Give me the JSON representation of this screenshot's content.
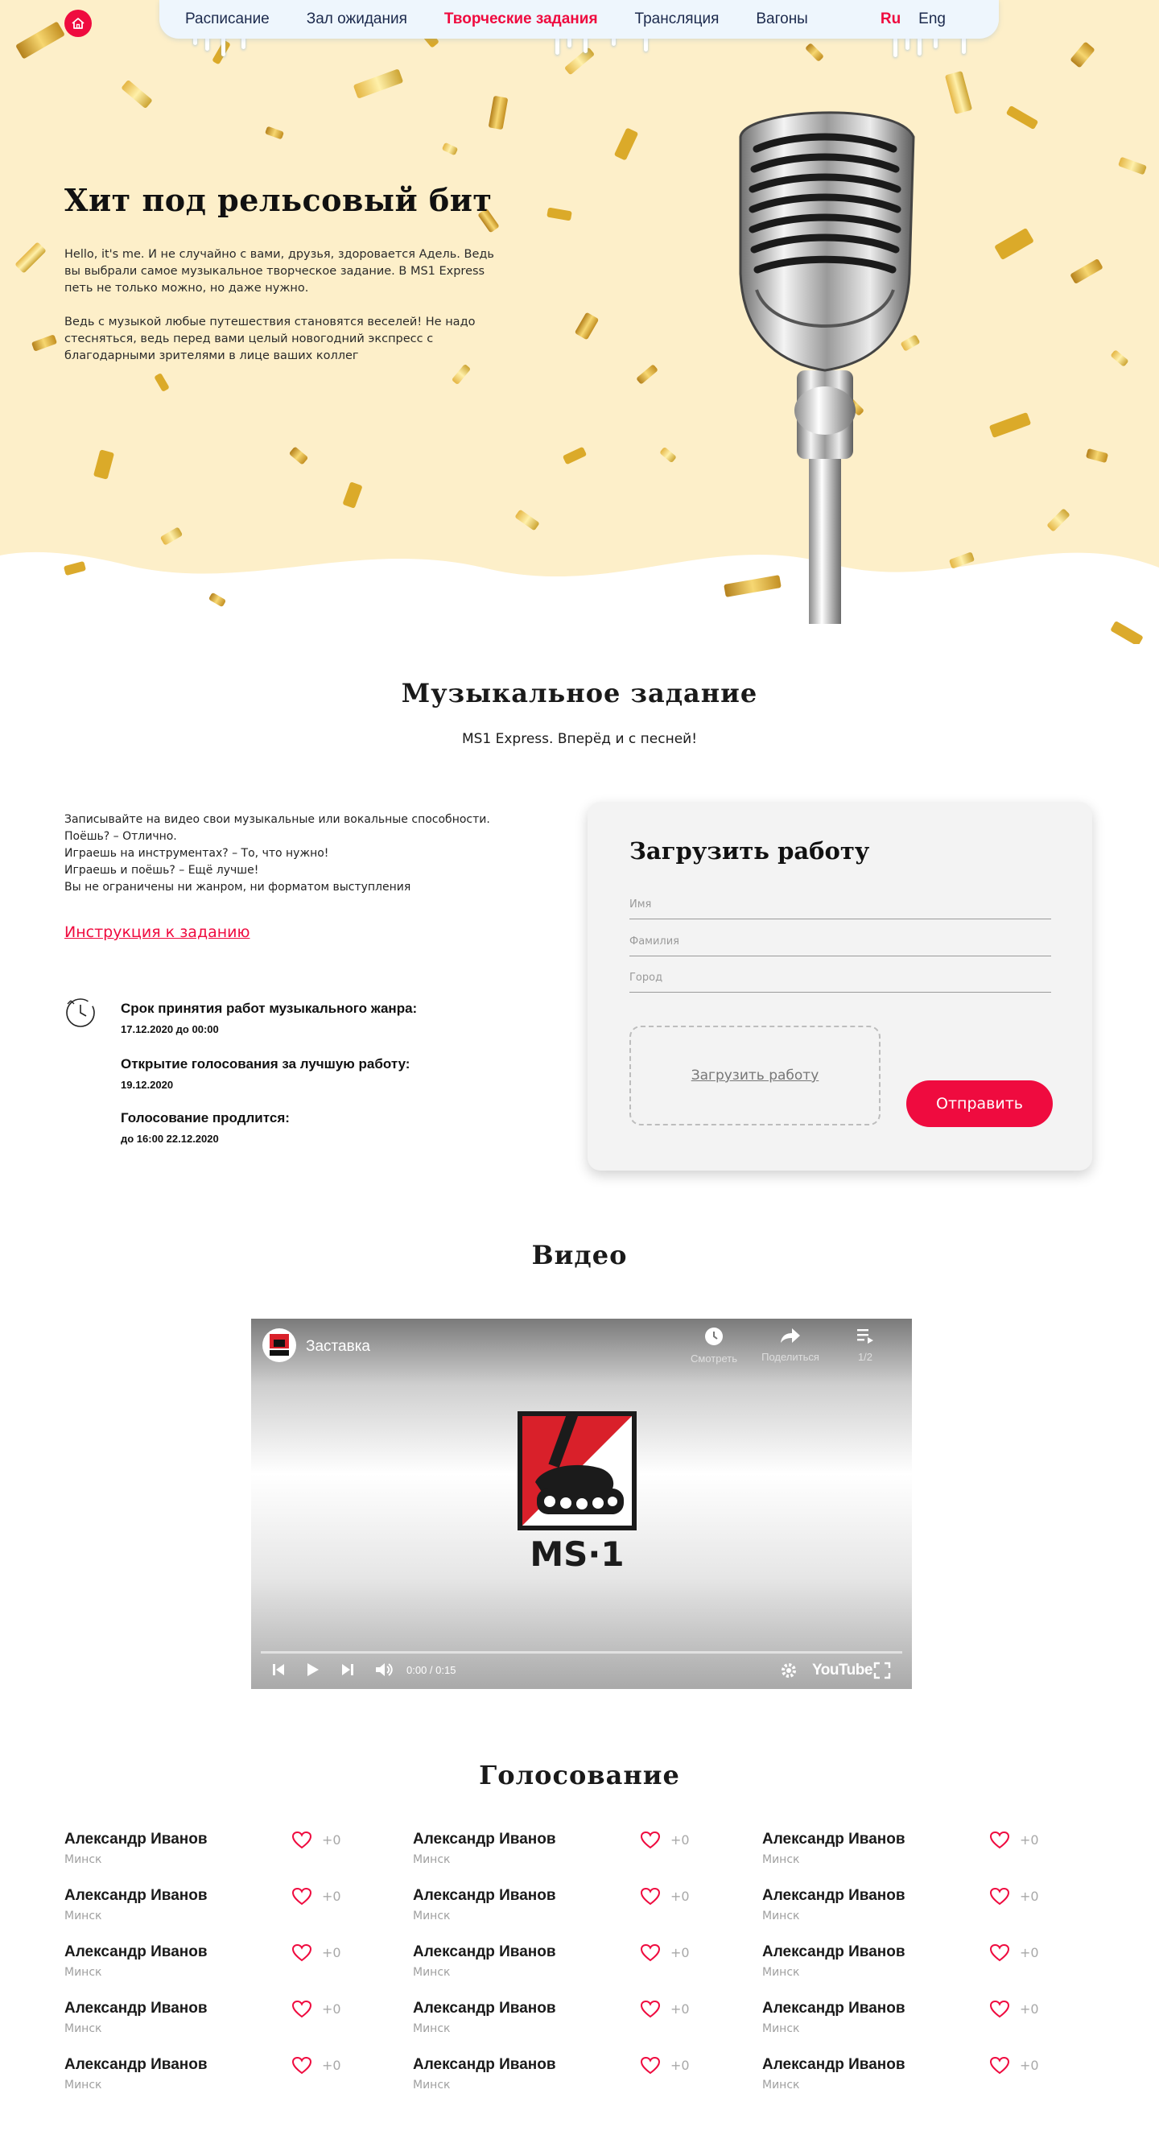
{
  "nav": {
    "items": [
      "Расписание",
      "Зал ожидания",
      "Творческие задания",
      "Трансляция",
      "Вагоны"
    ],
    "active_index": 2,
    "langs": [
      "Ru",
      "Eng"
    ],
    "active_lang": "Ru"
  },
  "hero": {
    "title": "Хит под рельсовый бит",
    "paragraph1": "Hello, it's me. И не случайно с вами, друзья, здоровается Адель. Ведь вы выбрали самое музыкальное творческое задание. В MS1 Express петь не только можно, но даже нужно.",
    "paragraph2": "Ведь с музыкой любые путешествия становятся веселей! Не надо стесняться, ведь перед вами целый новогодний экспресс с благодарными зрителями в лице ваших коллег"
  },
  "task": {
    "title": "Музыкальное задание",
    "subtitle": "MS1 Express. Вперёд и с песней!",
    "lines": [
      "Записывайте на видео свои музыкальные или вокальные способности.",
      "Поёшь? – Отлично.",
      "Играешь на инструментах? – То, что нужно!",
      "Играешь и поёшь? – Ещё лучше!",
      "Вы не ограничены ни жанром, ни форматом выступления"
    ],
    "instruction_link": "Инструкция к заданию",
    "deadlines": [
      {
        "label": "Срок принятия работ музыкального жанра:",
        "value": "17.12.2020 до 00:00"
      },
      {
        "label": "Открытие голосования за лучшую работу:",
        "value": "19.12.2020"
      },
      {
        "label": "Голосование продлится:",
        "value": "до 16:00 22.12.2020"
      }
    ]
  },
  "upload": {
    "title": "Загрузить работу",
    "fields": [
      "Имя",
      "Фамилия",
      "Город"
    ],
    "dropzone_label": "Загрузить работу",
    "submit_label": "Отправить"
  },
  "video": {
    "section_title": "Видео",
    "title": "Заставка",
    "watch_later_label": "Смотреть",
    "share_label": "Поделиться",
    "playlist_label": "1/2",
    "time": "0:00 / 0:15",
    "youtube_label": "YouTube",
    "logo_text": "MS·1",
    "progress": 0
  },
  "voting": {
    "title": "Голосование",
    "entries": [
      {
        "name": "Александр Иванов",
        "city": "Минск",
        "votes": "+0"
      },
      {
        "name": "Александр Иванов",
        "city": "Минск",
        "votes": "+0"
      },
      {
        "name": "Александр Иванов",
        "city": "Минск",
        "votes": "+0"
      },
      {
        "name": "Александр Иванов",
        "city": "Минск",
        "votes": "+0"
      },
      {
        "name": "Александр Иванов",
        "city": "Минск",
        "votes": "+0"
      },
      {
        "name": "Александр Иванов",
        "city": "Минск",
        "votes": "+0"
      },
      {
        "name": "Александр Иванов",
        "city": "Минск",
        "votes": "+0"
      },
      {
        "name": "Александр Иванов",
        "city": "Минск",
        "votes": "+0"
      },
      {
        "name": "Александр Иванов",
        "city": "Минск",
        "votes": "+0"
      },
      {
        "name": "Александр Иванов",
        "city": "Минск",
        "votes": "+0"
      },
      {
        "name": "Александр Иванов",
        "city": "Минск",
        "votes": "+0"
      },
      {
        "name": "Александр Иванов",
        "city": "Минск",
        "votes": "+0"
      },
      {
        "name": "Александр Иванов",
        "city": "Минск",
        "votes": "+0"
      },
      {
        "name": "Александр Иванов",
        "city": "Минск",
        "votes": "+0"
      },
      {
        "name": "Александр Иванов",
        "city": "Минск",
        "votes": "+0"
      }
    ]
  },
  "colors": {
    "accent": "#ef0b3f",
    "hero_bg": "#fdefc9",
    "nav_bg": "#eef6fd",
    "nav_text": "#1c2a4d",
    "gold": "#d9a521"
  },
  "icons": [
    "home-icon",
    "clock-icon",
    "heart-icon",
    "play-icon",
    "skip-back-icon",
    "skip-forward-icon",
    "volume-icon",
    "settings-icon",
    "fullscreen-icon",
    "watch-later-icon",
    "share-icon",
    "playlist-icon"
  ]
}
